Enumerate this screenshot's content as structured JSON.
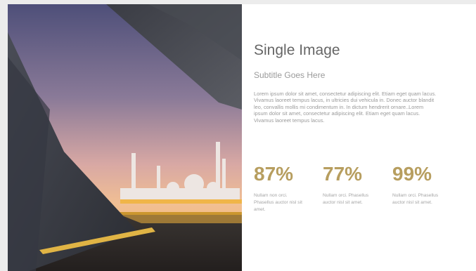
{
  "slide": {
    "title": "Single Image",
    "subtitle": "Subtitle Goes Here",
    "body": "Lorem ipsum dolor sit amet, consectetur adipiscing elit. Etiam eget quam lacus. Vivamus laoreet tempus lacus, in ultricies dui vehicula in. Donec auctor blandit leo, convallis mollis mi condimentum in. In dictum hendrerit ornare..Lorem ipsum dolor sit amet, consectetur adipiscing elit. Etiam eget quam lacus. Vivamus laoreet tempus lacus.",
    "stats": [
      {
        "value": "87%",
        "description": "Nullam non orci. Phasellus auctor nisl sit amet."
      },
      {
        "value": "77%",
        "description": "Nullam orci. Phasellus auctor nisl sit amet."
      },
      {
        "value": "99%",
        "description": "Nullam orci. Phasellus auctor nisl sit amet."
      }
    ]
  },
  "colors": {
    "accent": "#b79e5f",
    "title": "#666666",
    "muted_text": "#9a9a9a"
  },
  "image": {
    "description_icon": "mosque-sunset-photo"
  }
}
